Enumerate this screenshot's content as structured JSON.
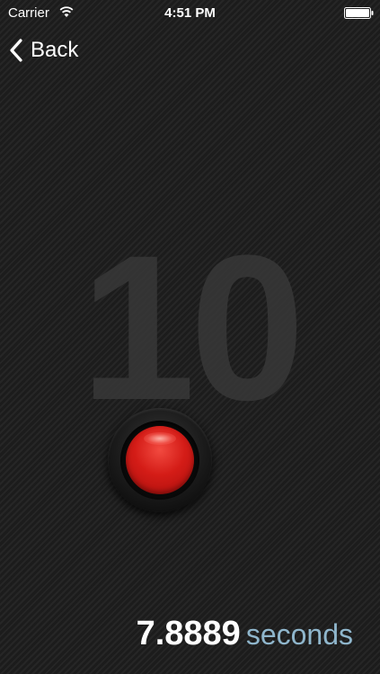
{
  "status_bar": {
    "carrier": "Carrier",
    "time": "4:51 PM",
    "wifi_icon": "wifi-icon",
    "battery_icon": "battery-full-icon"
  },
  "nav": {
    "back_label": "Back",
    "back_icon": "chevron-left-icon"
  },
  "countdown": {
    "value": "10"
  },
  "record_button": {
    "icon": "red-button-icon",
    "color": "#d41c17"
  },
  "timer": {
    "value": "7.8889",
    "unit": "seconds",
    "unit_color": "#8fb6cc"
  }
}
